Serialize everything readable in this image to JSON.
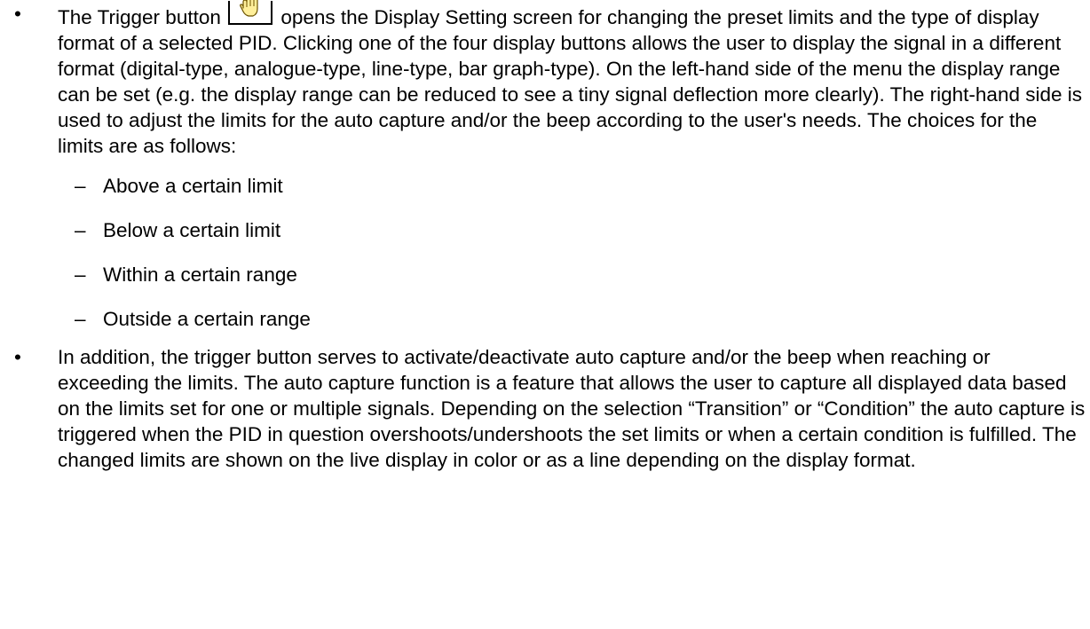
{
  "document": {
    "bullet_symbol": "•",
    "dash_symbol": "–",
    "paragraph1": {
      "before_icon": "The Trigger button",
      "after_icon": "opens the Display Setting screen for changing the preset limits and the type of display format of a selected PID. Clicking one of the four display buttons allows the user to display the signal in a different format (digital-type, analogue-type, line-type, bar graph-type). On the left-hand side of the menu the display range can be set (e.g. the display range can be reduced to see a tiny signal deflection more clearly). The right-hand side is used to adjust the limits for the auto capture and/or the beep according to the user's needs. The choices for the limits are as follows:"
    },
    "limit_choices": [
      "Above a certain limit",
      "Below a certain limit",
      "Within a certain range",
      "Outside a certain range"
    ],
    "paragraph2": "In addition, the trigger button serves to activate/deactivate auto capture and/or the beep when reaching or exceeding the limits. The auto capture function is a feature that allows the user to capture all displayed data based on the limits set for one or multiple signals. Depending on the selection “Transition” or “Condition” the auto capture is triggered when the PID in question overshoots/undershoots the set limits or when a certain condition is fulfilled. The changed limits are shown on the live display in color or as a line depending on the display format.",
    "trigger_icon": "hand-icon"
  }
}
